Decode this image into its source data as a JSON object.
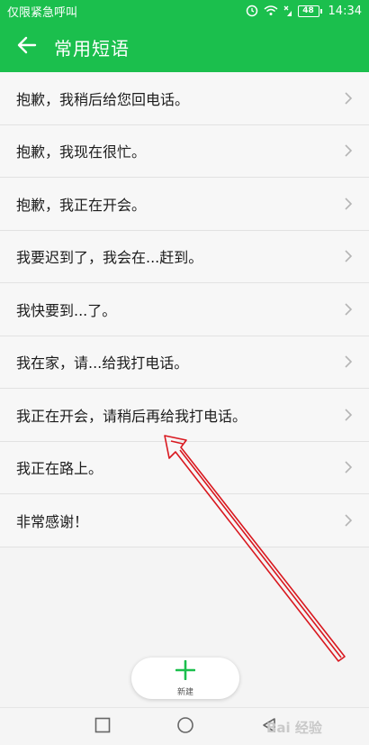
{
  "status_bar": {
    "left_text": "仅限紧急呼叫",
    "battery": "48",
    "time": "14:34"
  },
  "app_bar": {
    "title": "常用短语"
  },
  "phrases": [
    "抱歉，我稍后给您回电话。",
    "抱歉，我现在很忙。",
    "抱歉，我正在开会。",
    "我要迟到了，我会在...赶到。",
    "我快要到...了。",
    "我在家，请...给我打电话。",
    "我正在开会，请稍后再给我打电话。",
    "我正在路上。",
    "非常感谢！"
  ],
  "fab": {
    "label": "新建"
  },
  "watermark": {
    "text": "Bai 经验"
  },
  "colors": {
    "brand_green": "#1bbf4d",
    "annotation_red": "#d9181f"
  },
  "icons": {
    "back": "arrow-left-icon",
    "chevron": "chevron-right-icon",
    "add": "plus-icon"
  }
}
